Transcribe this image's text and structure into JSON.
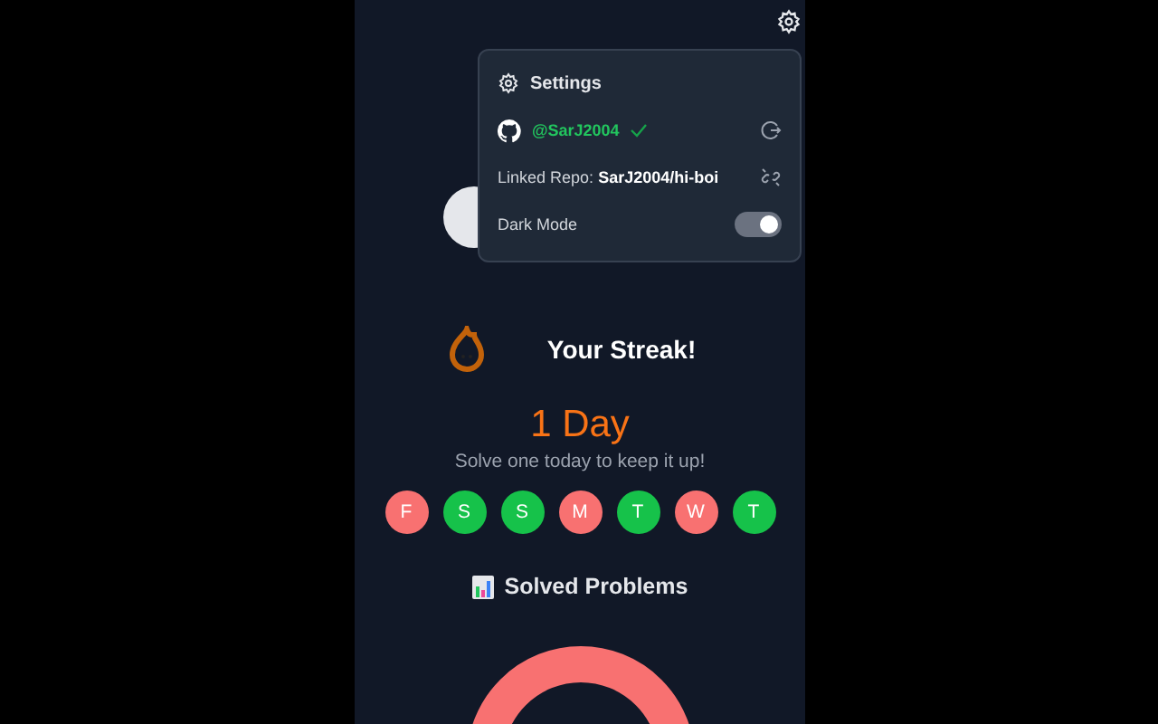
{
  "settings_menu": {
    "title": "Settings",
    "github_user": "@SarJ2004",
    "verified": true,
    "linked_repo_label": "Linked Repo:",
    "linked_repo": "SarJ2004/hi-boi",
    "dark_mode": {
      "label": "Dark Mode",
      "on": true
    }
  },
  "streak": {
    "title": "Your Streak!",
    "count": "1 Day",
    "subtitle": "Solve one today to keep it up!",
    "days": [
      {
        "label": "F",
        "done": false
      },
      {
        "label": "S",
        "done": true
      },
      {
        "label": "S",
        "done": true
      },
      {
        "label": "M",
        "done": false
      },
      {
        "label": "T",
        "done": true
      },
      {
        "label": "W",
        "done": false
      },
      {
        "label": "T",
        "done": true
      }
    ]
  },
  "solved": {
    "title": "Solved Problems"
  }
}
